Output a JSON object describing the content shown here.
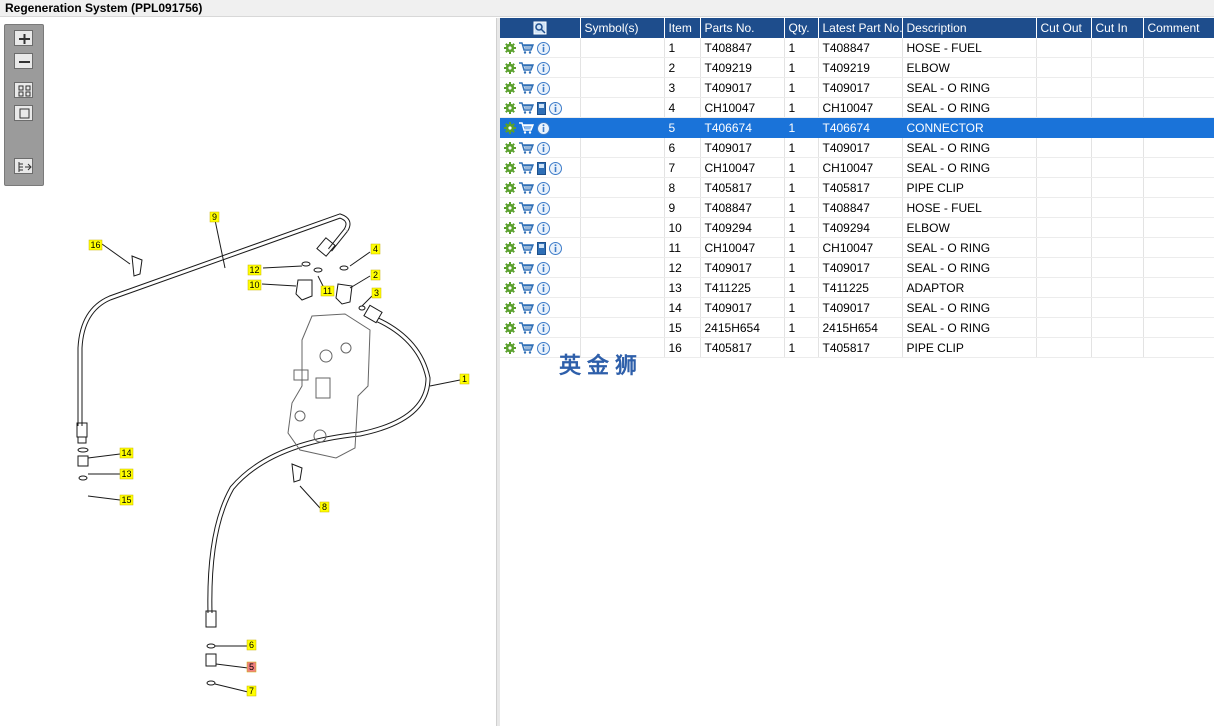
{
  "window": {
    "title": "Regeneration System (PPL091756)"
  },
  "toolbar": {
    "buttons": [
      {
        "name": "zoom-in-button",
        "icon": "zoom-in-icon"
      },
      {
        "name": "zoom-out-button",
        "icon": "zoom-out-icon"
      },
      {
        "name": "fit-all-button",
        "icon": "fit-all-icon"
      },
      {
        "name": "fit-window-button",
        "icon": "fit-window-icon"
      },
      {
        "name": "list-export-button",
        "icon": "list-export-icon"
      }
    ]
  },
  "diagram": {
    "callouts": [
      {
        "label": "9",
        "highlight": false
      },
      {
        "label": "16",
        "highlight": false
      },
      {
        "label": "4",
        "highlight": false
      },
      {
        "label": "12",
        "highlight": false
      },
      {
        "label": "2",
        "highlight": false
      },
      {
        "label": "10",
        "highlight": false
      },
      {
        "label": "11",
        "highlight": false
      },
      {
        "label": "3",
        "highlight": false
      },
      {
        "label": "1",
        "highlight": false
      },
      {
        "label": "14",
        "highlight": false
      },
      {
        "label": "13",
        "highlight": false
      },
      {
        "label": "15",
        "highlight": false
      },
      {
        "label": "8",
        "highlight": false
      },
      {
        "label": "6",
        "highlight": false
      },
      {
        "label": "5",
        "highlight": true
      },
      {
        "label": "7",
        "highlight": false
      }
    ],
    "callout_color": "#ffff00",
    "callout_highlight_color": "#f08080"
  },
  "table": {
    "headers": [
      "",
      "Symbol(s)",
      "Item",
      "Parts No.",
      "Qty.",
      "Latest Part No.",
      "Description",
      "Cut Out",
      "Cut In",
      "Comment"
    ],
    "selected_item": "5",
    "rows": [
      {
        "has_book": false,
        "symbols": "",
        "item": "1",
        "part_no": "T408847",
        "qty": "1",
        "latest": "T408847",
        "desc": "HOSE - FUEL",
        "cut_out": "",
        "cut_in": "",
        "comment": ""
      },
      {
        "has_book": false,
        "symbols": "",
        "item": "2",
        "part_no": "T409219",
        "qty": "1",
        "latest": "T409219",
        "desc": "ELBOW",
        "cut_out": "",
        "cut_in": "",
        "comment": ""
      },
      {
        "has_book": false,
        "symbols": "",
        "item": "3",
        "part_no": "T409017",
        "qty": "1",
        "latest": "T409017",
        "desc": "SEAL - O RING",
        "cut_out": "",
        "cut_in": "",
        "comment": ""
      },
      {
        "has_book": true,
        "symbols": "",
        "item": "4",
        "part_no": "CH10047",
        "qty": "1",
        "latest": "CH10047",
        "desc": "SEAL - O RING",
        "cut_out": "",
        "cut_in": "",
        "comment": ""
      },
      {
        "has_book": false,
        "symbols": "",
        "item": "5",
        "part_no": "T406674",
        "qty": "1",
        "latest": "T406674",
        "desc": "CONNECTOR",
        "cut_out": "",
        "cut_in": "",
        "comment": ""
      },
      {
        "has_book": false,
        "symbols": "",
        "item": "6",
        "part_no": "T409017",
        "qty": "1",
        "latest": "T409017",
        "desc": "SEAL - O RING",
        "cut_out": "",
        "cut_in": "",
        "comment": ""
      },
      {
        "has_book": true,
        "symbols": "",
        "item": "7",
        "part_no": "CH10047",
        "qty": "1",
        "latest": "CH10047",
        "desc": "SEAL - O RING",
        "cut_out": "",
        "cut_in": "",
        "comment": ""
      },
      {
        "has_book": false,
        "symbols": "",
        "item": "8",
        "part_no": "T405817",
        "qty": "1",
        "latest": "T405817",
        "desc": "PIPE CLIP",
        "cut_out": "",
        "cut_in": "",
        "comment": ""
      },
      {
        "has_book": false,
        "symbols": "",
        "item": "9",
        "part_no": "T408847",
        "qty": "1",
        "latest": "T408847",
        "desc": "HOSE - FUEL",
        "cut_out": "",
        "cut_in": "",
        "comment": ""
      },
      {
        "has_book": false,
        "symbols": "",
        "item": "10",
        "part_no": "T409294",
        "qty": "1",
        "latest": "T409294",
        "desc": "ELBOW",
        "cut_out": "",
        "cut_in": "",
        "comment": ""
      },
      {
        "has_book": true,
        "symbols": "",
        "item": "11",
        "part_no": "CH10047",
        "qty": "1",
        "latest": "CH10047",
        "desc": "SEAL - O RING",
        "cut_out": "",
        "cut_in": "",
        "comment": ""
      },
      {
        "has_book": false,
        "symbols": "",
        "item": "12",
        "part_no": "T409017",
        "qty": "1",
        "latest": "T409017",
        "desc": "SEAL - O RING",
        "cut_out": "",
        "cut_in": "",
        "comment": ""
      },
      {
        "has_book": false,
        "symbols": "",
        "item": "13",
        "part_no": "T411225",
        "qty": "1",
        "latest": "T411225",
        "desc": "ADAPTOR",
        "cut_out": "",
        "cut_in": "",
        "comment": ""
      },
      {
        "has_book": false,
        "symbols": "",
        "item": "14",
        "part_no": "T409017",
        "qty": "1",
        "latest": "T409017",
        "desc": "SEAL - O RING",
        "cut_out": "",
        "cut_in": "",
        "comment": ""
      },
      {
        "has_book": false,
        "symbols": "",
        "item": "15",
        "part_no": "2415H654",
        "qty": "1",
        "latest": "2415H654",
        "desc": "SEAL - O RING",
        "cut_out": "",
        "cut_in": "",
        "comment": ""
      },
      {
        "has_book": false,
        "symbols": "",
        "item": "16",
        "part_no": "T405817",
        "qty": "1",
        "latest": "T405817",
        "desc": "PIPE CLIP",
        "cut_out": "",
        "cut_in": "",
        "comment": ""
      }
    ]
  },
  "watermark": {
    "text": "英金狮",
    "color": "#2e5faa"
  },
  "colors": {
    "header_bg": "#1e4d8c",
    "selected_bg": "#1a73d9",
    "gear": "#5aa02c",
    "cart": "#2f6fb6",
    "info": "#3d7cc9"
  }
}
